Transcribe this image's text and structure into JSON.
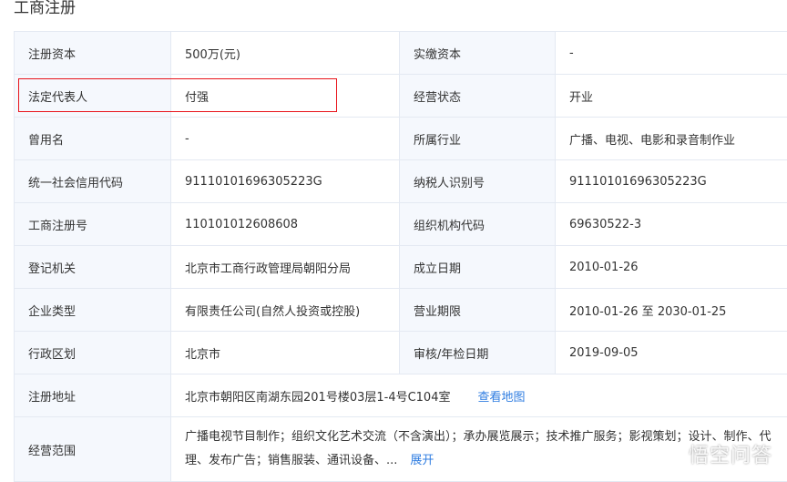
{
  "section_title": "工商注册",
  "rows": [
    {
      "l1": "注册资本",
      "v1": "500万(元)",
      "l2": "实缴资本",
      "v2": "-"
    },
    {
      "l1": "法定代表人",
      "v1": "付强",
      "l2": "经营状态",
      "v2": "开业"
    },
    {
      "l1": "曾用名",
      "v1": "-",
      "l2": "所属行业",
      "v2": "广播、电视、电影和录音制作业"
    },
    {
      "l1": "统一社会信用代码",
      "v1": "91110101696305223G",
      "l2": "纳税人识别号",
      "v2": "91110101696305223G"
    },
    {
      "l1": "工商注册号",
      "v1": "110101012608608",
      "l2": "组织机构代码",
      "v2": "69630522-3"
    },
    {
      "l1": "登记机关",
      "v1": "北京市工商行政管理局朝阳分局",
      "l2": "成立日期",
      "v2": "2010-01-26"
    },
    {
      "l1": "企业类型",
      "v1": "有限责任公司(自然人投资或控股)",
      "l2": "营业期限",
      "v2": "2010-01-26 至 2030-01-25"
    },
    {
      "l1": "行政区划",
      "v1": "北京市",
      "l2": "审核/年检日期",
      "v2": "2019-09-05"
    }
  ],
  "address": {
    "label": "注册地址",
    "value": "北京市朝阳区南湖东园201号楼03层1-4号C104室",
    "link": "查看地图"
  },
  "scope": {
    "label": "经营范围",
    "value": "广播电视节目制作；组织文化艺术交流（不含演出）；承办展览展示；技术推广服务；影视策划；设计、制作、代理、发布广告；销售服装、通讯设备、...",
    "link": "展开"
  },
  "watermark": "悟空问答"
}
